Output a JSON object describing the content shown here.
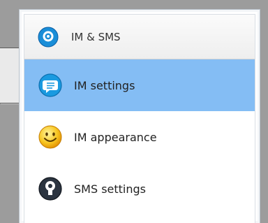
{
  "header": {
    "label": "IM & SMS",
    "icon": "im-sms-icon"
  },
  "items": [
    {
      "label": "IM settings",
      "icon": "chat-bubble-icon",
      "selected": true
    },
    {
      "label": "IM appearance",
      "icon": "smiley-icon",
      "selected": false
    },
    {
      "label": "SMS settings",
      "icon": "sms-phone-icon",
      "selected": false
    }
  ],
  "colors": {
    "selection": "#84bdf4",
    "panel_border": "#b9c2cc",
    "background": "#9c9c9c"
  }
}
